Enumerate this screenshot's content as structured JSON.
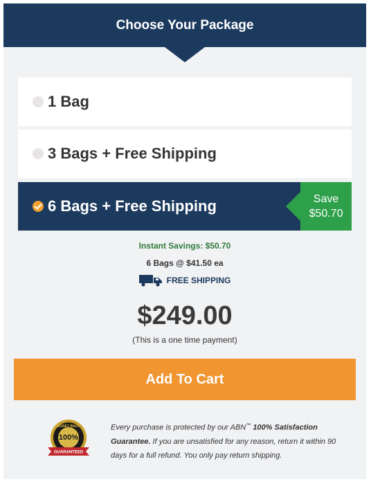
{
  "header": {
    "title": "Choose Your Package"
  },
  "options": [
    {
      "label": "1 Bag",
      "selected": false
    },
    {
      "label": "3 Bags + Free Shipping",
      "selected": false
    },
    {
      "label": "6 Bags + Free Shipping",
      "selected": true,
      "badge_line1": "Save",
      "badge_line2": "$50.70"
    }
  ],
  "summary": {
    "instant_savings": "Instant Savings: $50.70",
    "per_bag": "6 Bags @ $41.50 ea",
    "shipping": "FREE SHIPPING",
    "price": "$249.00",
    "payment_note": "(This is a one time payment)"
  },
  "cart": {
    "button_label": "Add To Cart"
  },
  "guarantee": {
    "seal_top": "MONEY BACK",
    "seal_pct": "100%",
    "seal_ribbon": "GUARANTEED",
    "text_1": "Every purchase is protected by our ABN",
    "tm": "™",
    "text_bold": "100% Satisfaction Guarantee.",
    "text_2": "If you are unsatisfied for any reason, return it within 90 days for a full refund. You only pay return shipping."
  },
  "colors": {
    "navy": "#1c3a5e",
    "orange": "#f09530",
    "green": "#2ea04a",
    "savings_green": "#2f7a3a"
  }
}
